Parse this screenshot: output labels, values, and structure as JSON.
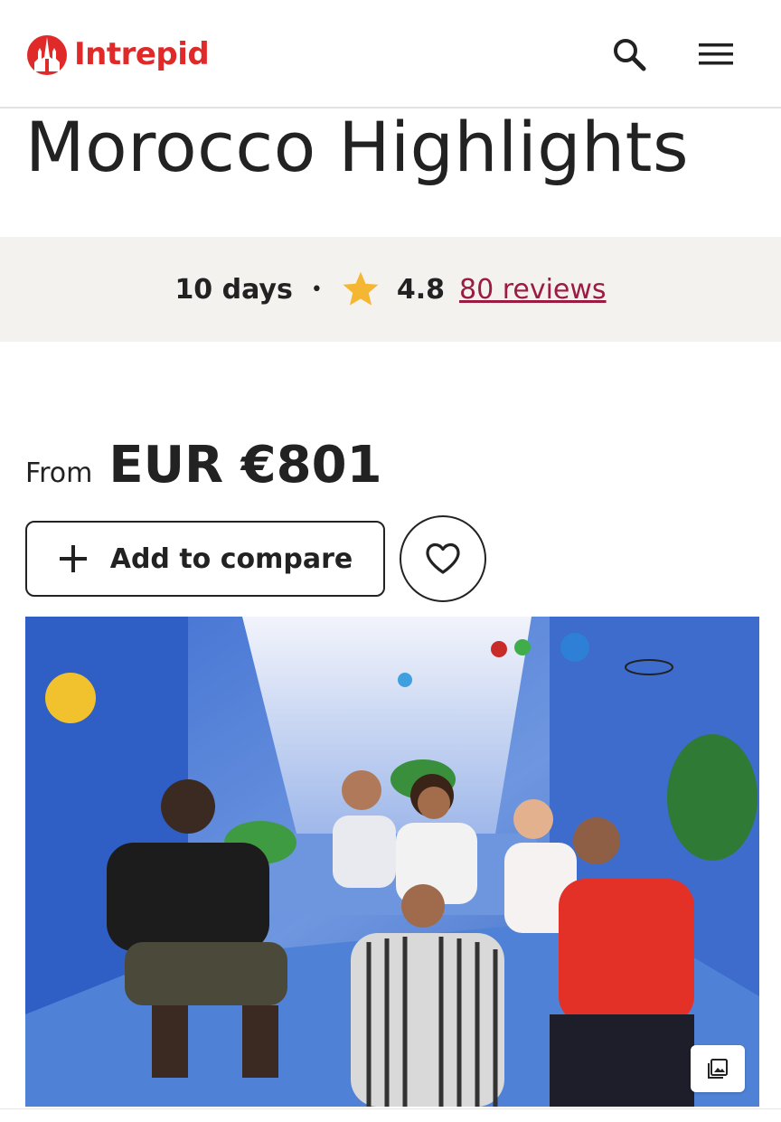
{
  "header": {
    "brand_name": "Intrepid",
    "brand_color": "#e02a2a",
    "icons": {
      "logo": "intrepid-logo-icon",
      "search": "search-icon",
      "menu": "hamburger-menu-icon"
    }
  },
  "trip": {
    "title": "Morocco Highlights",
    "duration": "10 days",
    "separator": "•",
    "rating": "4.8",
    "reviews_label": "80 reviews",
    "star_color": "#f5b733",
    "link_color": "#9b1b43"
  },
  "pricing": {
    "from_label": "From",
    "price": "EUR €801"
  },
  "actions": {
    "compare_label": "Add to compare",
    "favourite_icon": "heart-icon",
    "gallery_icon": "image-gallery-icon"
  },
  "hero": {
    "image_icon": "group-photo-chefchaouen"
  }
}
